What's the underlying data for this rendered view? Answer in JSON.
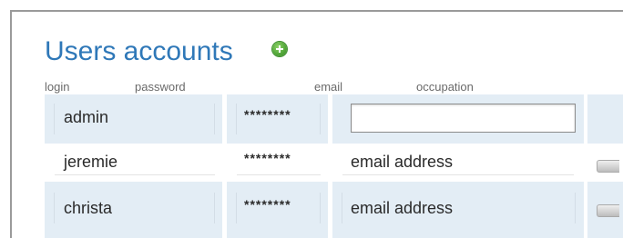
{
  "section": {
    "title": "Users accounts",
    "add_icon": "add-circle-icon"
  },
  "columns": [
    "login",
    "password",
    "email",
    "occupation"
  ],
  "rows": [
    {
      "login": "admin",
      "password": "********",
      "email": "",
      "email_editable": true
    },
    {
      "login": "jeremie",
      "password": "********",
      "email": "email address"
    },
    {
      "login": "christa",
      "password": "********",
      "email": "email address"
    }
  ],
  "colors": {
    "title": "#2f78b8",
    "row_shade": "#e3edf5",
    "add_icon": "#54a83a"
  }
}
